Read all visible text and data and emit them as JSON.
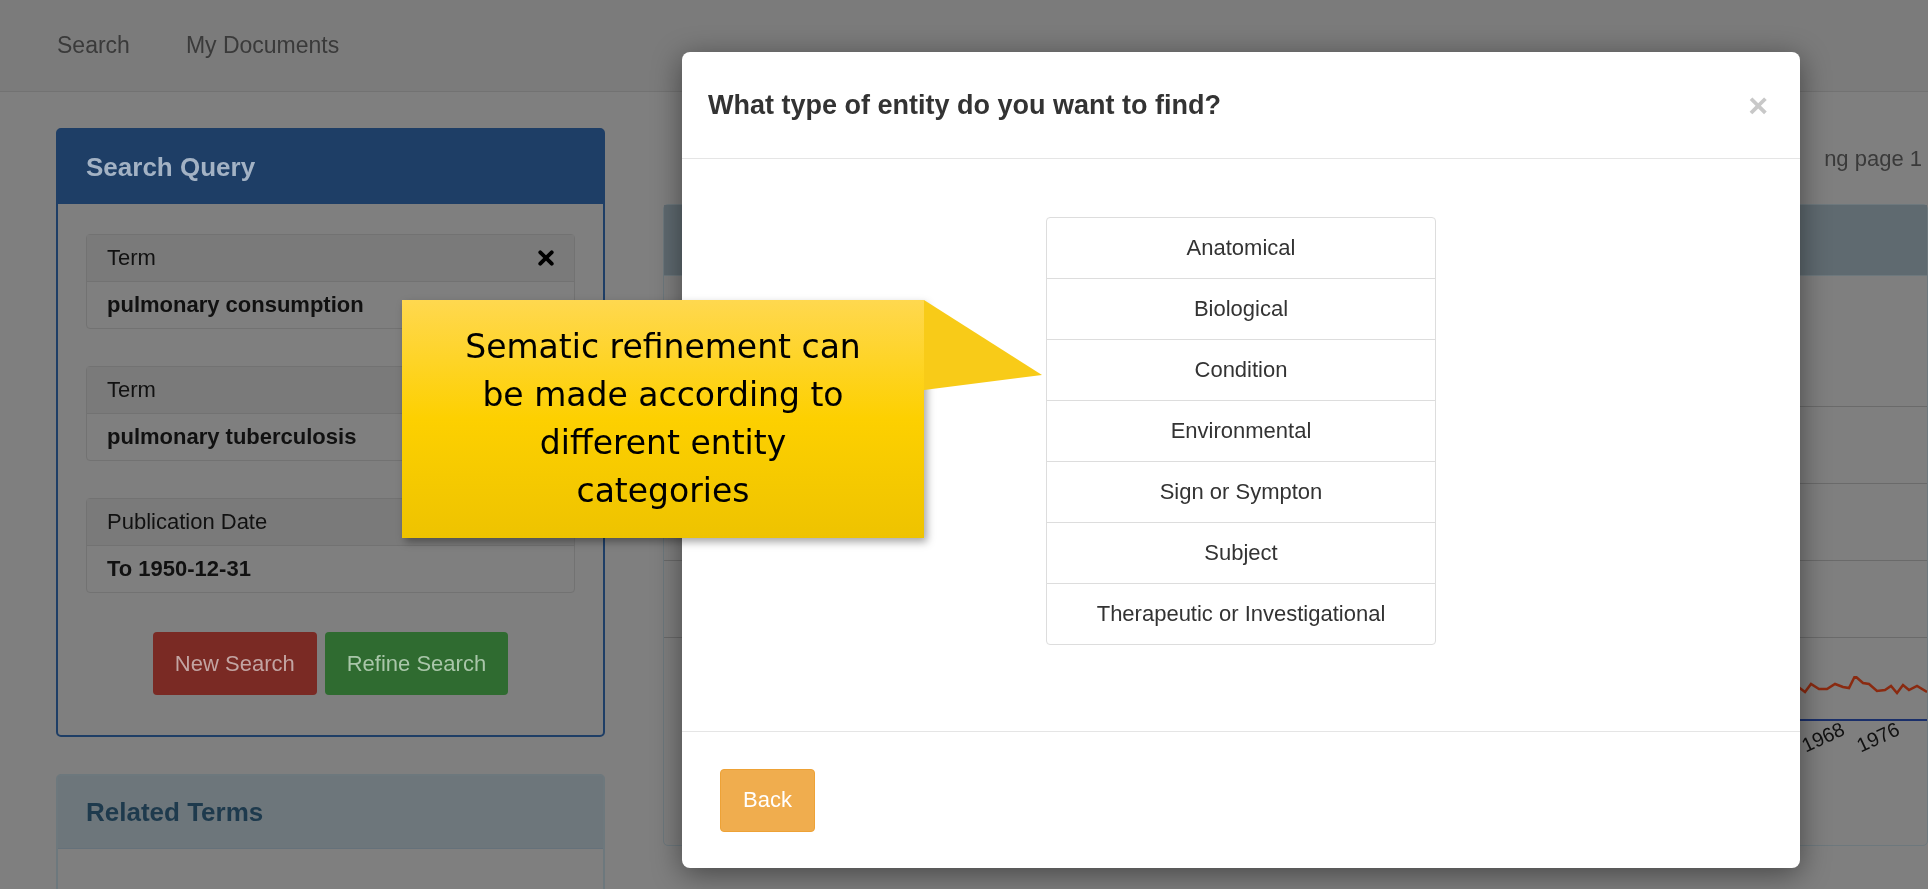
{
  "navbar": {
    "items": [
      "Search",
      "My Documents"
    ]
  },
  "search_query": {
    "title": "Search Query",
    "criteria": [
      {
        "label": "Term",
        "value": "pulmonary consumption",
        "removable": true
      },
      {
        "label": "Term",
        "value": "pulmonary tuberculosis"
      },
      {
        "label": "Publication Date",
        "value": "To 1950-12-31"
      }
    ],
    "buttons": [
      {
        "label": "New Search",
        "kind": "danger"
      },
      {
        "label": "Refine Search",
        "kind": "success"
      }
    ]
  },
  "related_terms": {
    "title": "Related Terms"
  },
  "results": {
    "page_info": "ng page 1",
    "chart_labels": [
      "1968",
      "1976"
    ]
  },
  "modal": {
    "title": "What type of entity do you want to find?",
    "close": "×",
    "options": [
      "Anatomical",
      "Biological",
      "Condition",
      "Environmental",
      "Sign or Sympton",
      "Subject",
      "Therapeutic or Investigational"
    ],
    "back_button": "Back"
  },
  "callout": {
    "text": "Sematic refinement can be made according to different entity categories"
  }
}
